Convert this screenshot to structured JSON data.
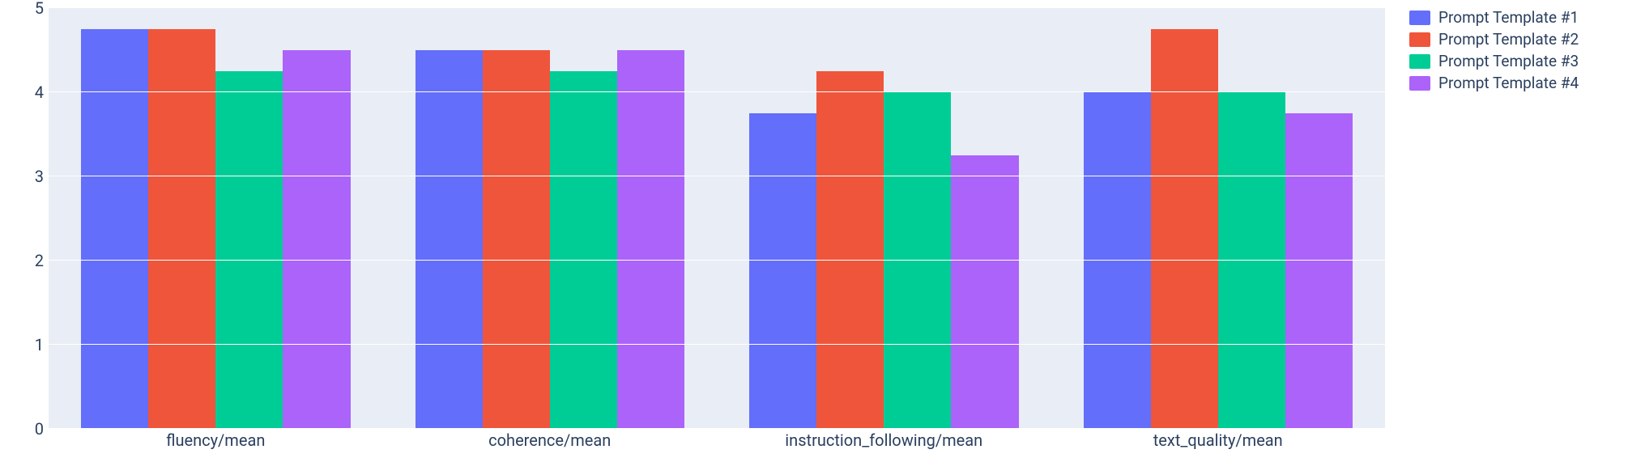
{
  "chart_data": {
    "type": "bar",
    "categories": [
      "fluency/mean",
      "coherence/mean",
      "instruction_following/mean",
      "text_quality/mean"
    ],
    "series": [
      {
        "name": "Prompt Template #1",
        "color": "#636efa",
        "values": [
          4.75,
          4.5,
          3.75,
          4.0
        ]
      },
      {
        "name": "Prompt Template #2",
        "color": "#ef553b",
        "values": [
          4.75,
          4.5,
          4.25,
          4.75
        ]
      },
      {
        "name": "Prompt Template #3",
        "color": "#00cc96",
        "values": [
          4.25,
          4.25,
          4.0,
          4.0
        ]
      },
      {
        "name": "Prompt Template #4",
        "color": "#ab63fa",
        "values": [
          4.5,
          4.5,
          3.25,
          3.75
        ]
      }
    ],
    "ylim": [
      0,
      5
    ],
    "yticks": [
      0,
      1,
      2,
      3,
      4,
      5
    ],
    "title": "",
    "xlabel": "",
    "ylabel": "",
    "legend_position": "right"
  }
}
